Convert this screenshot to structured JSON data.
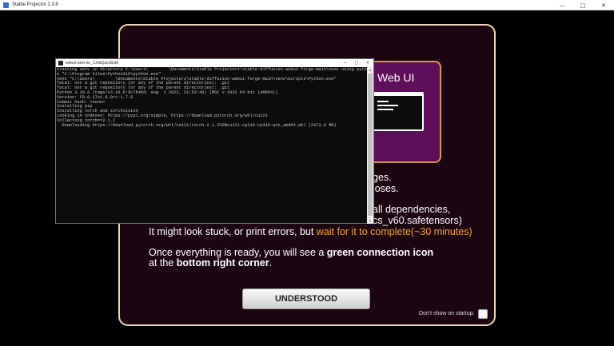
{
  "window": {
    "title": "Stable Projector 1.3.6",
    "min": "—",
    "max": "□",
    "close": "✕"
  },
  "card": {
    "title_partial": "Web UI"
  },
  "info": {
    "line1_partial": "ges.",
    "line2_partial": "loses.",
    "line3_partial": "all dependencies,",
    "line4_partial": "cs_v60.safetensors)",
    "line5_a": "It might look stuck, or print errors, but ",
    "line5_b": "wait for it to complete(~30 minutes)",
    "line6_a": "Once everything is ready, you will see a ",
    "line6_b": "green connection icon",
    "line7_a": "at the ",
    "line7_b": "bottom right corner",
    "line7_c": "."
  },
  "understood_label": "UNDERSTOOD",
  "startup_label": "Don't show on startup:",
  "console": {
    "title": "webui-user.no_CmdQuickEdit",
    "min": "—",
    "max": "□",
    "close": "✕",
    "lines": [
      "Creating venv in directory C:\\Users\\        \\Documents\\Stable Projectorz\\stable-diffusion-webui-forge-main\\venv using pytho",
      "n \"C:\\Program Files\\Python310\\python.exe\"",
      "venv \"C:\\Users\\        \\Documents\\Stable Projectorz\\stable-diffusion-webui-forge-main\\venv\\Scripts\\Python.exe\"",
      "fatal: not a git repository (or any of the parent directories): .git",
      "fatal: not a git repository (or any of the parent directories): .git",
      "Python 3.10.6 (tags/v3.10.6:9c7b4bd, Aug  1 2022, 21:53:49) [MSC v.1932 64 bit (AMD64)]",
      "Version: f0.0.17v1.8.0rc-1.7.0",
      "Commit hash: <none>",
      "Installing pip",
      "Installing torch and torchvision",
      "Looking in indexes: https://pypi.org/simple, https://download.pytorch.org/whl/cu121",
      "Collecting torch==2.1.2",
      "  Downloading https://download.pytorch.org/whl/cu121/torch-2.1.2%2Bcu121-cp310-cp310-win_amd64.whl (2473.9 MB)"
    ]
  }
}
